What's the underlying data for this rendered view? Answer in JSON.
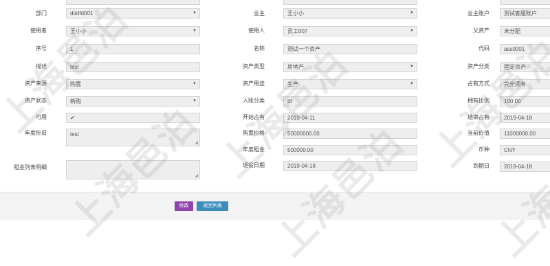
{
  "watermark": "上海邑泊",
  "top_partial": {
    "col1_label": "",
    "col1_value": "",
    "col2_label": "",
    "col2_value": "",
    "col3_label": "",
    "col3_value": ""
  },
  "col1": {
    "dept_label": "部门",
    "dept_value": "dddfd001",
    "user_label": "使用者",
    "user_value": "王小小",
    "seq_label": "序号",
    "seq_value": "1",
    "desc_label": "描述",
    "desc_value": "test",
    "source_label": "资产来源",
    "source_value": "购置",
    "status_label": "资产状态",
    "status_value": "新购",
    "available_label": "可用",
    "available_value": "✔",
    "annual_dep_label": "年度折旧",
    "annual_dep_value": "test",
    "rent_detail_label": "租金列表明细",
    "rent_detail_value": ""
  },
  "col2": {
    "owner_label": "业主",
    "owner_value": "王小小",
    "user_label": "使用人",
    "user_value": "员工007",
    "name_label": "名称",
    "name_value": "测试一个资产",
    "type_label": "资产类型",
    "type_value": "房地产",
    "usage_label": "资产用途",
    "usage_value": "生产",
    "ledger_label": "入账分类",
    "ledger_value": "ttt",
    "start_label": "开始占有",
    "start_value": "2019-04-11",
    "purchase_label": "购置价格",
    "purchase_value": "50000000.00",
    "annual_rent_label": "年度租金",
    "annual_rent_value": "500000.00",
    "due_label": "退役日期",
    "due_value": "2019-04-18"
  },
  "col3": {
    "owner_acct_label": "业主账户",
    "owner_acct_value": "测试客服账户",
    "parent_label": "父资产",
    "parent_value": "未分配",
    "code_label": "代码",
    "code_value": "ass0001",
    "category_label": "资产分类",
    "category_value": "固定资产",
    "occupy_label": "占有方式",
    "occupy_value": "完全拥有",
    "ratio_label": "拥有比例",
    "ratio_value": "100.00",
    "end_label": "结束占有",
    "end_value": "2019-04-18",
    "current_label": "当前价值",
    "current_value": "11000000.00",
    "currency_label": "币种",
    "currency_value": "CNY",
    "expire_label": "到期日",
    "expire_value": "2019-04-18"
  },
  "buttons": {
    "edit": "修改",
    "back": "返回列表"
  }
}
